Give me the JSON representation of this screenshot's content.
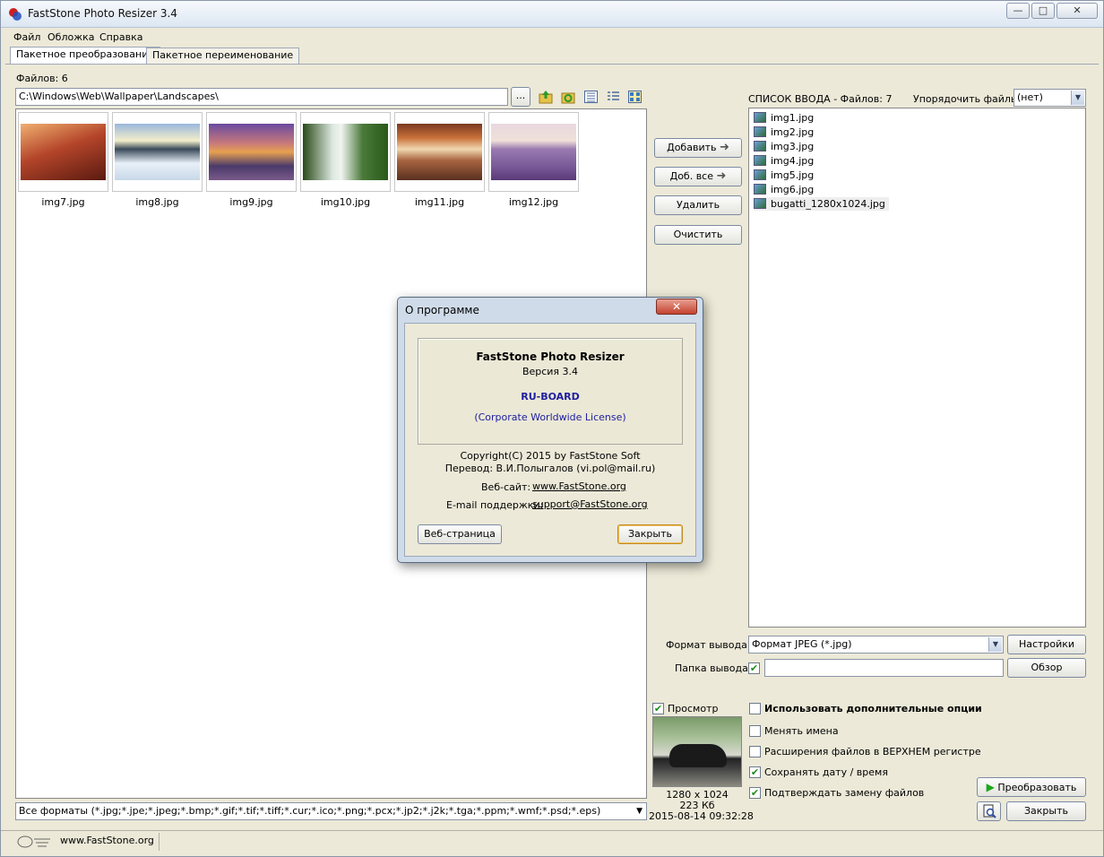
{
  "window": {
    "title": "FastStone Photo Resizer 3.4",
    "min_label": "—",
    "max_label": "□",
    "close_label": "✕"
  },
  "menu": [
    "Файл",
    "Обложка",
    "Справка"
  ],
  "tabs": [
    "Пакетное преобразование",
    "Пакетное переименование"
  ],
  "left": {
    "files_count_label": "Файлов: 6",
    "path": "C:\\Windows\\Web\\Wallpaper\\Landscapes\\",
    "browse_label": "...",
    "thumbnails": [
      {
        "name": "img7.jpg",
        "color": "#b4452a"
      },
      {
        "name": "img8.jpg",
        "color": "#7fa6c8"
      },
      {
        "name": "img9.jpg",
        "color": "#8f6aa0"
      },
      {
        "name": "img10.jpg",
        "color": "#4a7a3a"
      },
      {
        "name": "img11.jpg",
        "color": "#a86440"
      },
      {
        "name": "img12.jpg",
        "color": "#8a6fa8"
      }
    ],
    "filter": "Все форматы (*.jpg;*.jpe;*.jpeg;*.bmp;*.gif;*.tif;*.tiff;*.cur;*.ico;*.png;*.pcx;*.jp2;*.j2k;*.tga;*.ppm;*.wmf;*.psd;*.eps)"
  },
  "middle_buttons": {
    "add": "Добавить",
    "add_all": "Доб. все",
    "remove": "Удалить",
    "clear": "Очистить"
  },
  "right": {
    "list_title": "СПИСОК ВВОДА  -  Файлов: 7",
    "sort_label": "Упорядочить файлы:",
    "sort_value": "(нет)",
    "files": [
      "img1.jpg",
      "img2.jpg",
      "img3.jpg",
      "img4.jpg",
      "img5.jpg",
      "img6.jpg",
      "bugatti_1280x1024.jpg"
    ],
    "format_label": "Формат вывода:",
    "format_value": "Формат JPEG (*.jpg)",
    "settings_label": "Настройки",
    "folder_label": "Папка вывода:",
    "folder_value": "",
    "browse_label": "Обзор",
    "preview_label": "Просмотр",
    "preview_size": "1280 x 1024",
    "preview_filesize": "223 Кб",
    "preview_date": "2015-08-14 09:32:28",
    "options": [
      {
        "label": "Использовать дополнительные опции",
        "checked": false,
        "bold": true
      },
      {
        "label": "Менять имена",
        "checked": false
      },
      {
        "label": "Расширения файлов в ВЕРХНЕМ регистре",
        "checked": false
      },
      {
        "label": "Сохранять дату / время",
        "checked": true
      },
      {
        "label": "Подтверждать замену файлов",
        "checked": true
      }
    ],
    "convert_label": "Преобразовать",
    "close_label": "Закрыть"
  },
  "status": {
    "website": "www.FastStone.org"
  },
  "about_dialog": {
    "title": "О программе",
    "close_label": "✕",
    "product": "FastStone Photo Resizer",
    "version": "Версия 3.4",
    "licensee": "RU-BOARD",
    "license": "(Corporate Worldwide License)",
    "copyright": "Copyright(C) 2015 by FastStone Soft",
    "translation": "Перевод: В.И.Полыгалов (vi.pol@mail.ru)",
    "website_label": "Веб-сайт:",
    "website_value": "www.FastStone.org",
    "email_label": "E-mail поддержки:",
    "email_value": "support@FastStone.org",
    "webpage_button": "Веб-страница",
    "close_button": "Закрыть"
  },
  "colors": {
    "accent_blue": "#2020a0",
    "check_green": "#1e8a1e",
    "play_green": "#1aa81a"
  }
}
